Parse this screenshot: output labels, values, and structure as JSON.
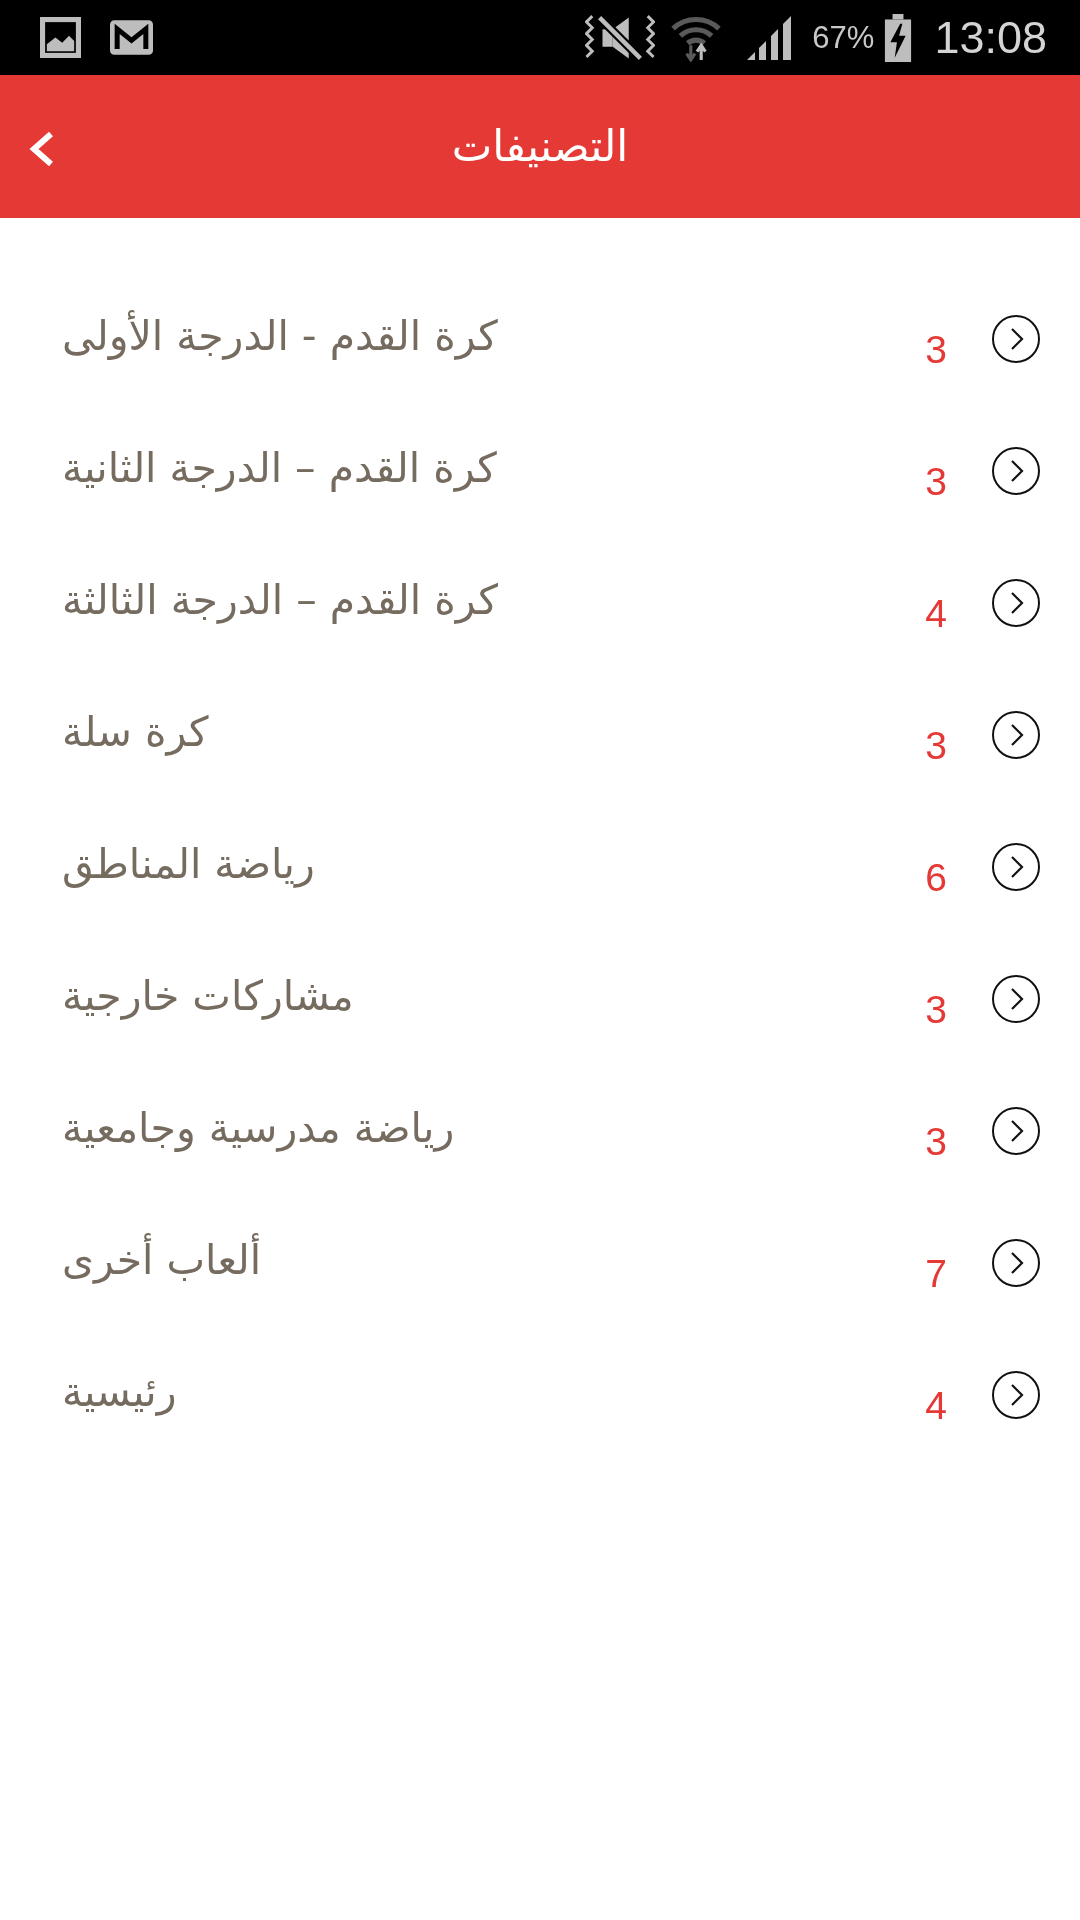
{
  "status_bar": {
    "battery_text": "67%",
    "time": "13:08"
  },
  "app_bar": {
    "title": "التصنيفات"
  },
  "categories": [
    {
      "name": "كرة القدم - الدرجة الأولى",
      "count": "3"
    },
    {
      "name": "كرة القدم – الدرجة الثانية",
      "count": "3"
    },
    {
      "name": "كرة القدم – الدرجة الثالثة",
      "count": "4"
    },
    {
      "name": "كرة سلة",
      "count": "3"
    },
    {
      "name": "رياضة المناطق",
      "count": "6"
    },
    {
      "name": "مشاركات خارجية",
      "count": "3"
    },
    {
      "name": "رياضة مدرسية وجامعية",
      "count": "3"
    },
    {
      "name": "ألعاب أخرى",
      "count": "7"
    },
    {
      "name": "رئيسية",
      "count": "4"
    }
  ]
}
